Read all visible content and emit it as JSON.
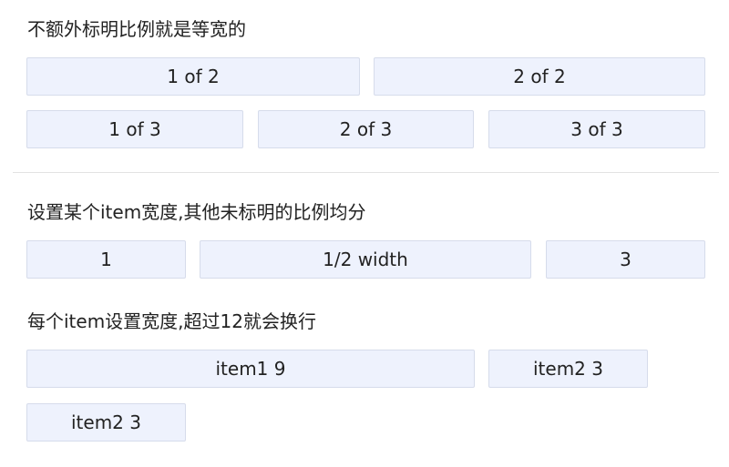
{
  "section1": {
    "title": "不额外标明比例就是等宽的",
    "row_a": [
      "1 of 2",
      "2 of 2"
    ],
    "row_b": [
      "1 of 3",
      "2 of 3",
      "3 of 3"
    ]
  },
  "section2": {
    "title": "设置某个item宽度,其他未标明的比例均分",
    "cells": [
      "1",
      "1/2 width",
      "3"
    ]
  },
  "section3": {
    "title": "每个item设置宽度,超过12就会换行",
    "cells": [
      "item1 9",
      "item2 3",
      "item2 3"
    ]
  },
  "colors": {
    "cell_bg": "#eef2fd",
    "cell_border": "#d6dceb"
  }
}
